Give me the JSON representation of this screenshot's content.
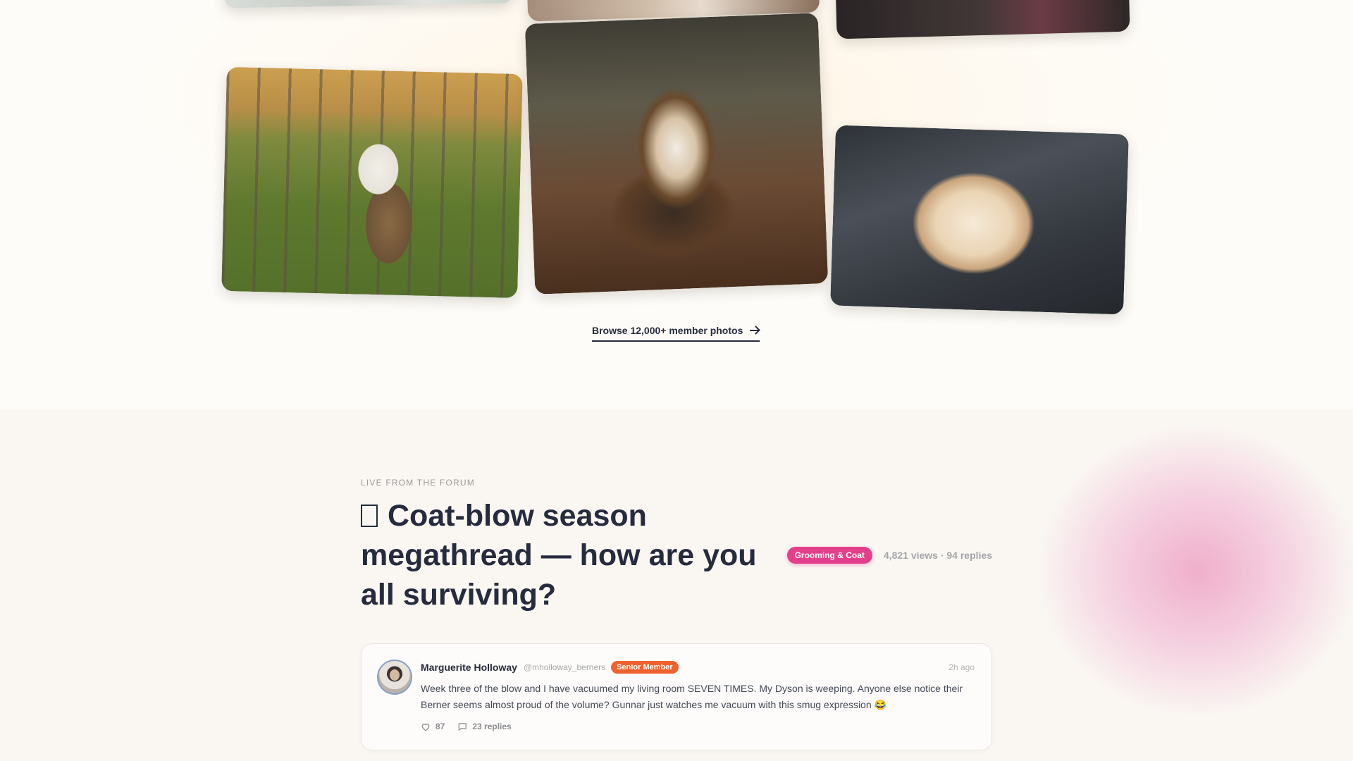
{
  "gallery": {
    "photos": [
      {
        "id": "partial-top-left",
        "description_icon": "photo"
      },
      {
        "id": "partial-top-middle",
        "description_icon": "photo"
      },
      {
        "id": "partial-top-right",
        "description_icon": "photo"
      },
      {
        "id": "dogs-at-fence",
        "description_icon": "photo"
      },
      {
        "id": "sheltie-in-leaves",
        "description_icon": "photo"
      },
      {
        "id": "fluffy-dog-on-couch",
        "description_icon": "photo"
      }
    ],
    "browse_label": "Browse 12,000+ member photos",
    "browse_icon": "arrow-right-icon"
  },
  "forum": {
    "eyebrow": "LIVE FROM THE FORUM",
    "thread_title": "Coat-blow season megathread — how are you all surviving?",
    "category": "Grooming & Coat",
    "stats": "4,821 views · 94 replies",
    "post": {
      "author": "Marguerite Holloway",
      "handle": "@mholloway_berners",
      "role": "Senior Member",
      "time": "2h ago",
      "body": "Week three of the blow and I have vacuumed my living room SEVEN TIMES. My Dyson is weeping. Anyone else notice their Berner seems almost proud of the volume? Gunnar just watches me vacuum with this smug expression 😂",
      "likes": "87",
      "replies": "23 replies"
    }
  },
  "colors": {
    "ink": "#262b3d",
    "category_tag": "#e43f8a",
    "role_badge": "#f0622d",
    "page_bg": "#fefcf8",
    "forum_bg": "#faf7f3"
  }
}
